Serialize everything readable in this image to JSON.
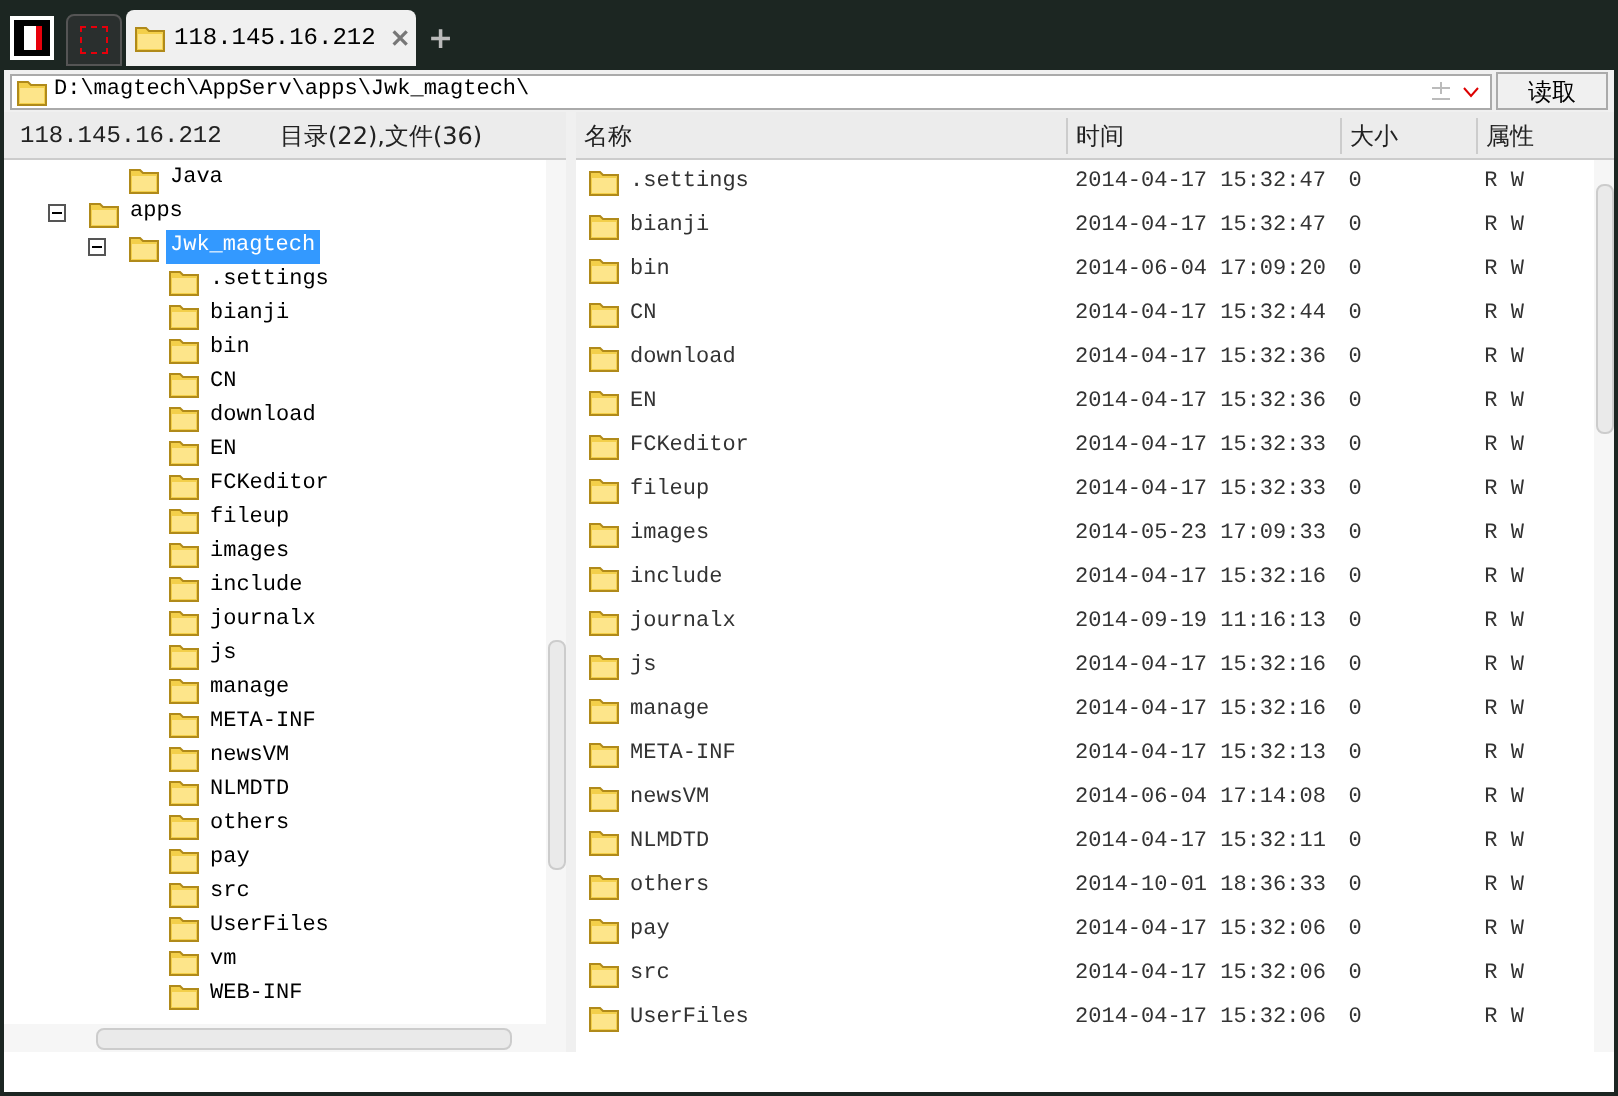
{
  "tabs": [
    {
      "label": "118.145.16.212",
      "selected": true
    }
  ],
  "new_tab": "+",
  "address": {
    "value": "D:\\magtech\\AppServ\\apps\\Jwk_magtech\\",
    "button": "读取"
  },
  "tree_header": {
    "host": "118.145.16.212",
    "summary": "目录(22),文件(36)"
  },
  "tree": [
    {
      "children": [
        {
          "label": "Java",
          "selected": false
        }
      ]
    },
    {
      "label": "apps",
      "expanded": true,
      "selected": false,
      "children": [
        {
          "label": "Jwk_magtech",
          "expanded": true,
          "selected": true,
          "children": [
            {
              "label": ".settings",
              "selected": false
            },
            {
              "label": "bianji",
              "selected": false
            },
            {
              "label": "bin",
              "selected": false
            },
            {
              "label": "CN",
              "selected": false
            },
            {
              "label": "download",
              "selected": false
            },
            {
              "label": "EN",
              "selected": false
            },
            {
              "label": "FCKeditor",
              "selected": false
            },
            {
              "label": "fileup",
              "selected": false
            },
            {
              "label": "images",
              "selected": false
            },
            {
              "label": "include",
              "selected": false
            },
            {
              "label": "journalx",
              "selected": false
            },
            {
              "label": "js",
              "selected": false
            },
            {
              "label": "manage",
              "selected": false
            },
            {
              "label": "META-INF",
              "selected": false
            },
            {
              "label": "newsVM",
              "selected": false
            },
            {
              "label": "NLMDTD",
              "selected": false
            },
            {
              "label": "others",
              "selected": false
            },
            {
              "label": "pay",
              "selected": false
            },
            {
              "label": "src",
              "selected": false
            },
            {
              "label": "UserFiles",
              "selected": false
            },
            {
              "label": "vm",
              "selected": false
            },
            {
              "label": "WEB-INF",
              "selected": false
            }
          ]
        }
      ]
    }
  ],
  "table": {
    "columns": [
      "名称",
      "时间",
      "大小",
      "属性"
    ],
    "rows": [
      [
        ".settings",
        "2014-04-17 15:32:47",
        "0",
        "R W"
      ],
      [
        "bianji",
        "2014-04-17 15:32:47",
        "0",
        "R W"
      ],
      [
        "bin",
        "2014-06-04 17:09:20",
        "0",
        "R W"
      ],
      [
        "CN",
        "2014-04-17 15:32:44",
        "0",
        "R W"
      ],
      [
        "download",
        "2014-04-17 15:32:36",
        "0",
        "R W"
      ],
      [
        "EN",
        "2014-04-17 15:32:36",
        "0",
        "R W"
      ],
      [
        "FCKeditor",
        "2014-04-17 15:32:33",
        "0",
        "R W"
      ],
      [
        "fileup",
        "2014-04-17 15:32:33",
        "0",
        "R W"
      ],
      [
        "images",
        "2014-05-23 17:09:33",
        "0",
        "R W"
      ],
      [
        "include",
        "2014-04-17 15:32:16",
        "0",
        "R W"
      ],
      [
        "journalx",
        "2014-09-19 11:16:13",
        "0",
        "R W"
      ],
      [
        "js",
        "2014-04-17 15:32:16",
        "0",
        "R W"
      ],
      [
        "manage",
        "2014-04-17 15:32:16",
        "0",
        "R W"
      ],
      [
        "META-INF",
        "2014-04-17 15:32:13",
        "0",
        "R W"
      ],
      [
        "newsVM",
        "2014-06-04 17:14:08",
        "0",
        "R W"
      ],
      [
        "NLMDTD",
        "2014-04-17 15:32:11",
        "0",
        "R W"
      ],
      [
        "others",
        "2014-10-01 18:36:33",
        "0",
        "R W"
      ],
      [
        "pay",
        "2014-04-17 15:32:06",
        "0",
        "R W"
      ],
      [
        "src",
        "2014-04-17 15:32:06",
        "0",
        "R W"
      ],
      [
        "UserFiles",
        "2014-04-17 15:32:06",
        "0",
        "R W"
      ]
    ]
  }
}
